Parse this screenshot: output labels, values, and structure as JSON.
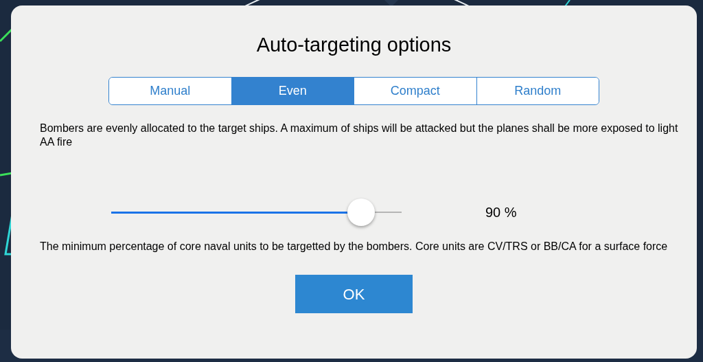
{
  "dialog": {
    "title": "Auto-targeting options",
    "tabs": [
      {
        "label": "Manual",
        "selected": false
      },
      {
        "label": "Even",
        "selected": true
      },
      {
        "label": "Compact",
        "selected": false
      },
      {
        "label": "Random",
        "selected": false
      }
    ],
    "mode_description": "Bombers are evenly allocated to the target ships. A maximum of ships will be attacked but the planes shall be more exposed to light AA fire",
    "slider": {
      "level": 0.86,
      "reading": "90 %"
    },
    "slider_description": "The minimum percentage of core naval units to be targetted by the bombers. Core units are CV/TRS or BB/CA for a surface force",
    "ok_button": "OK"
  }
}
